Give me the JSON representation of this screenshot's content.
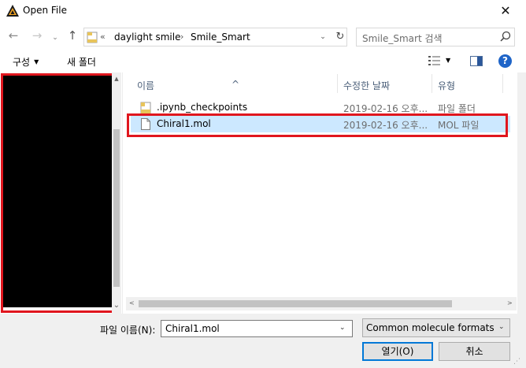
{
  "window": {
    "title": "Open File",
    "close_glyph": "✕",
    "app_icon": "app-logo-icon"
  },
  "nav": {
    "back_glyph": "←",
    "forward_glyph": "→",
    "recent_glyph": "⌄",
    "up_glyph": "↑",
    "breadcrumb": {
      "overflow": "«",
      "items": [
        "daylight smile",
        "Smile_Smart"
      ],
      "separator": "›"
    },
    "dropdown_glyph": "⌄",
    "refresh_glyph": "↻",
    "search_placeholder": "Smile_Smart 검색"
  },
  "toolbar": {
    "organize_label": "구성",
    "organize_caret": "▼",
    "new_folder_label": "새 폴더",
    "view_caret": "▼",
    "help_label": "?"
  },
  "columns": {
    "name": "이름",
    "date": "수정한 날짜",
    "type": "유형",
    "sort_glyph": "^"
  },
  "files": [
    {
      "name": ".ipynb_checkpoints",
      "date": "2019-02-16 오후...",
      "type": "파일 폴더",
      "kind": "folder"
    },
    {
      "name": "Chiral1.mol",
      "date": "2019-02-16 오후...",
      "type": "MOL 파일",
      "kind": "file",
      "selected": true
    }
  ],
  "scroll": {
    "up": "▲",
    "down": "⌄",
    "left": "<",
    "right": ">"
  },
  "bottom": {
    "filename_label": "파일 이름(N):",
    "filename_value": "Chiral1.mol",
    "filename_dd": "⌄",
    "filetype_value": "Common molecule formats (*.",
    "filetype_dd": "⌄",
    "open_label": "열기(O)",
    "cancel_label": "취소",
    "grip": "⋰"
  },
  "colors": {
    "selection": "#cce8ff",
    "highlight_border": "#e0161e",
    "accent": "#0078d7"
  }
}
